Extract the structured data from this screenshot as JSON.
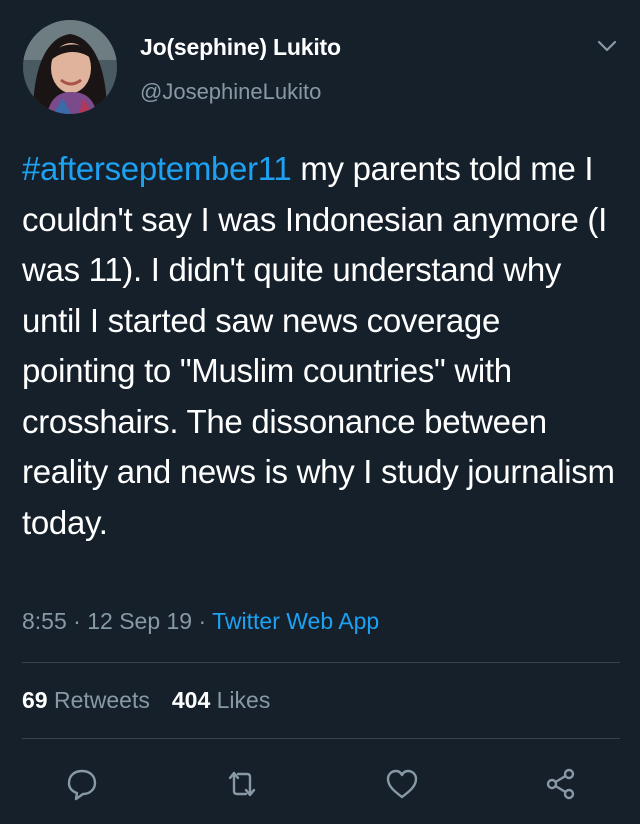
{
  "user": {
    "name": "Jo(sephine) Lukito",
    "handle": "@JosephineLukito"
  },
  "tweet": {
    "hashtag": "#afterseptember11",
    "body": " my parents told me I couldn't say I was Indonesian anymore (I was 11). I didn't quite understand why until I started saw  news coverage pointing to \"Muslim countries\" with crosshairs. The dissonance between reality and news is why I study journalism today.",
    "time": "8:55",
    "separator1": " · ",
    "date": "12 Sep 19",
    "separator2": " · ",
    "source": "Twitter Web App"
  },
  "stats": {
    "retweets_count": "69",
    "retweets_label": "Retweets",
    "likes_count": "404",
    "likes_label": "Likes"
  },
  "icons": {
    "menu": "chevron-down-icon",
    "reply": "reply-icon",
    "retweet": "retweet-icon",
    "like": "heart-icon",
    "share": "share-icon"
  },
  "colors": {
    "background": "#15202b",
    "accent": "#1da1f2",
    "secondary_text": "#8899a6",
    "divider": "#38444d"
  }
}
